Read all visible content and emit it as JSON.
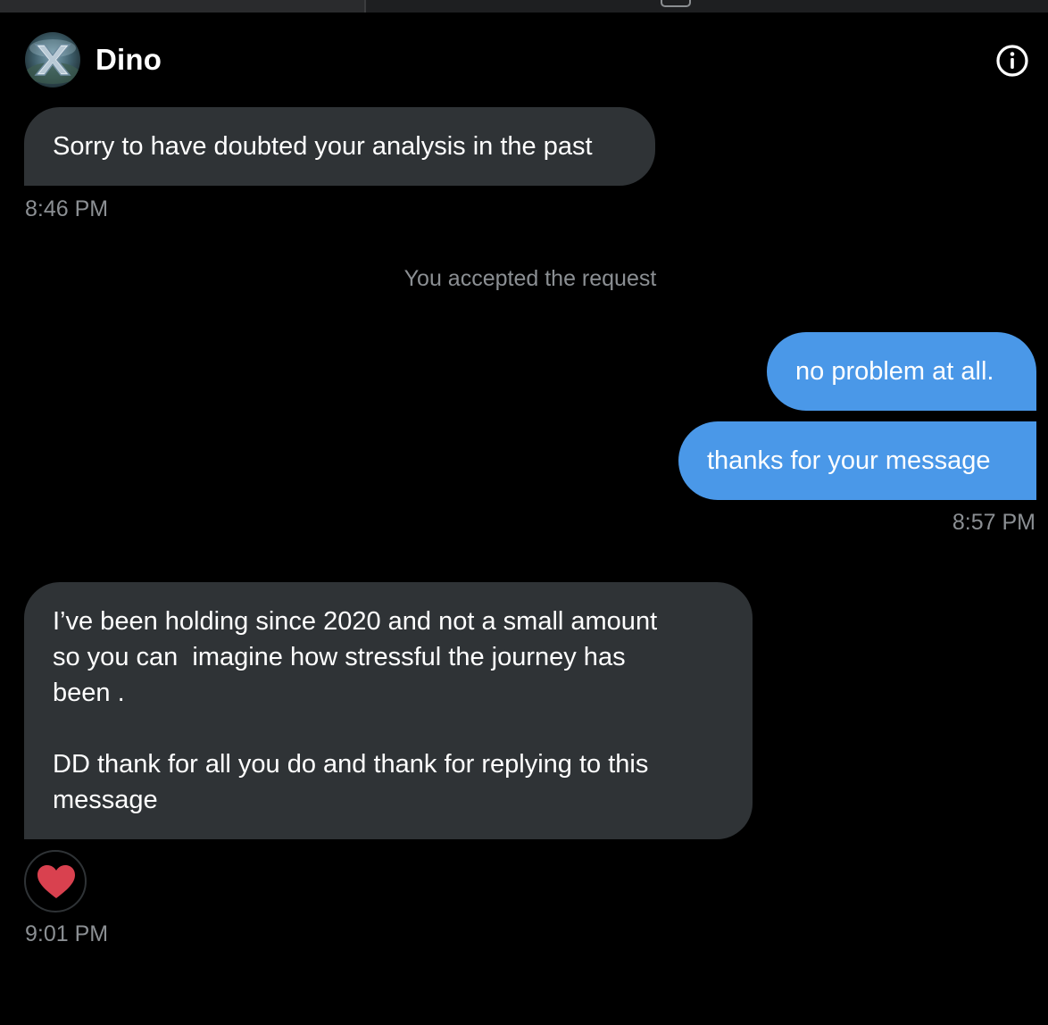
{
  "header": {
    "contact_name": "Dino",
    "avatar_icon": "avatar-x-logo-icon",
    "info_icon": "info-icon"
  },
  "colors": {
    "background": "#000000",
    "incoming_bubble": "#2f3336",
    "outgoing_bubble": "#4a98e8",
    "muted_text": "#8b8f93",
    "reaction_heart": "#d9414f"
  },
  "messages": [
    {
      "direction": "incoming",
      "text": "Sorry to have doubted your analysis in the past",
      "time": "8:46 PM"
    },
    {
      "direction": "system",
      "text": "You accepted the request"
    },
    {
      "direction": "outgoing",
      "text": "no problem at all."
    },
    {
      "direction": "outgoing",
      "text": "thanks for your message",
      "time": "8:57 PM"
    },
    {
      "direction": "incoming",
      "paragraphs": [
        "I’ve been holding since 2020 and not a small amount\nso you can  imagine how stressful the journey has\nbeen .",
        "DD thank for all you do and thank for replying to this\nmessage"
      ],
      "reaction": "heart-icon",
      "time": "9:01 PM"
    }
  ]
}
